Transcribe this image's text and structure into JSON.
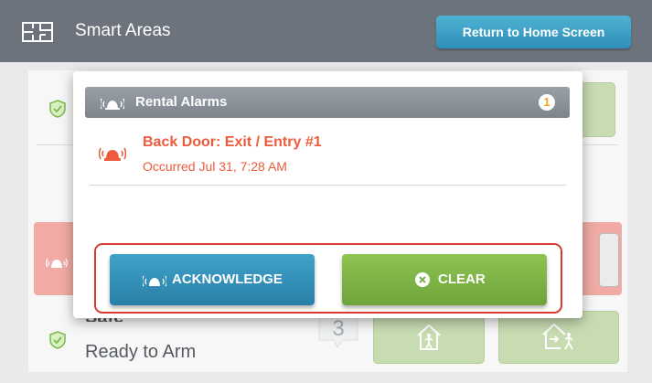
{
  "header": {
    "title": "Smart Areas",
    "icon": "floorplan-icon",
    "home_button_label": "Return to Home Screen"
  },
  "background": {
    "status_label": "Safe",
    "status_detail": "Ready to Arm",
    "count": "3",
    "icons": [
      "shield-check-icon",
      "alarm-siren-icon",
      "house-stay-icon",
      "house-away-icon"
    ]
  },
  "modal": {
    "title": "Rental Alarms",
    "badge_count": "1",
    "icon": "alarm-siren-icon",
    "alarms": [
      {
        "title": "Back Door: Exit / Entry #1",
        "time": "Occurred Jul 31, 7:28 AM"
      }
    ]
  },
  "actions": {
    "acknowledge_label": "ACKNOWLEDGE",
    "clear_label": "CLEAR"
  },
  "colors": {
    "header_bg": "#6d737c",
    "home_button": "#3da4cc",
    "alarm_text": "#ec5b3b",
    "acknowledge": "#3397bf",
    "clear": "#7db447",
    "highlight_border": "#d63b33",
    "badge_text": "#f0a31c"
  }
}
